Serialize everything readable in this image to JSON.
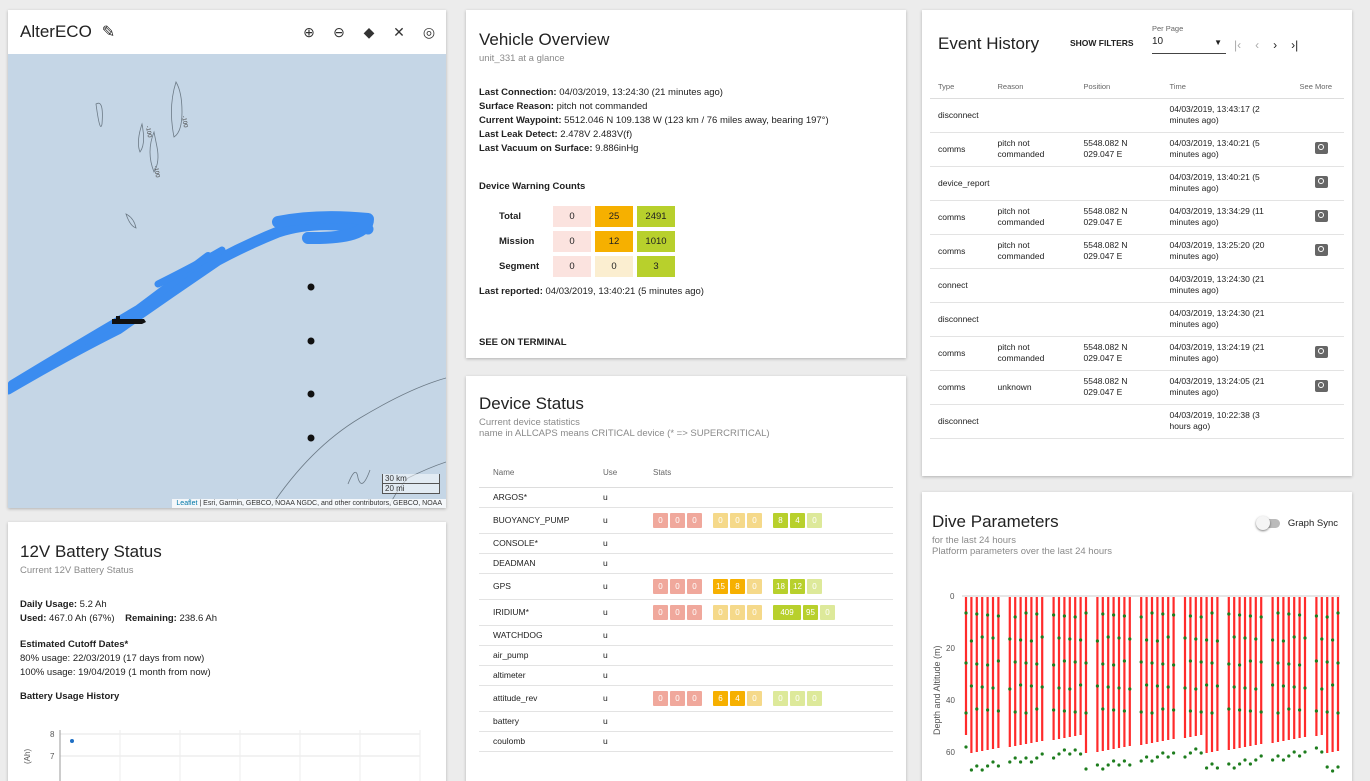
{
  "map": {
    "title": "AlterECO",
    "scale_km": "30 km",
    "scale_mi": "20 mi",
    "attribution_leaflet": "Leaflet",
    "attribution_rest": " | Esri, Garmin, GEBCO, NOAA NGDC, and other contributors, GEBCO, NOAA",
    "contour_labels": [
      "-100",
      "-100",
      "-100"
    ],
    "colors": {
      "water": "#c5d6e6",
      "track": "#3b8cf0",
      "marker": "#111111"
    }
  },
  "battery": {
    "title": "12V Battery Status",
    "subtitle": "Current 12V Battery Status",
    "daily_label": "Daily Usage:",
    "daily_value": " 5.2 Ah",
    "used_label": "Used:",
    "used_value": " 467.0 Ah (67%)",
    "remaining_label": "Remaining:",
    "remaining_value": " 238.6 Ah",
    "cutoff_title": "Estimated Cutoff Dates*",
    "cutoff_80": "80% usage: 22/03/2019 (17 days from now)",
    "cutoff_100": "100% usage: 19/04/2019 (1 month from now)",
    "history_title": "Battery Usage History",
    "chart_ylabel": "(Ah)",
    "chart_ticks": [
      "8",
      "7"
    ]
  },
  "vehicle": {
    "title": "Vehicle Overview",
    "subtitle": "unit_331 at a glance",
    "last_connection_label": "Last Connection:",
    "last_connection_value": " 04/03/2019, 13:24:30 (21 minutes ago)",
    "surface_reason_label": "Surface Reason:",
    "surface_reason_value": " pitch not commanded",
    "waypoint_label": "Current Waypoint:",
    "waypoint_value": " 5512.046 N 109.138 W (123 km / 76 miles away, bearing 197°)",
    "leak_label": "Last Leak Detect:",
    "leak_value": " 2.478V  2.483V(f)",
    "vacuum_label": "Last Vacuum on Surface:",
    "vacuum_value": " 9.886inHg",
    "warnings_title": "Device Warning Counts",
    "warnings": [
      {
        "label": "Total",
        "values": [
          "0",
          "25",
          "2491"
        ]
      },
      {
        "label": "Mission",
        "values": [
          "0",
          "12",
          "1010"
        ]
      },
      {
        "label": "Segment",
        "values": [
          "0",
          "0",
          "3"
        ]
      }
    ],
    "last_reported_label": "Last reported:",
    "last_reported_value": " 04/03/2019, 13:40:21 (5 minutes ago)",
    "see_terminal": "SEE ON TERMINAL"
  },
  "device": {
    "title": "Device Status",
    "subtitle1": "Current device statistics",
    "subtitle2": "name in ALLCAPS means CRITICAL device (* => SUPERCRITICAL)",
    "columns": [
      "Name",
      "Use",
      "Stats"
    ],
    "rows": [
      {
        "name": "ARGOS*",
        "use": "u"
      },
      {
        "name": "BUOYANCY_PUMP",
        "use": "u",
        "stats": [
          [
            "0",
            "0",
            "0"
          ],
          [
            "0",
            "0",
            "0"
          ],
          [
            "8",
            "4",
            "0"
          ]
        ]
      },
      {
        "name": "CONSOLE*",
        "use": "u"
      },
      {
        "name": "DEADMAN",
        "use": "u"
      },
      {
        "name": "GPS",
        "use": "u",
        "stats": [
          [
            "0",
            "0",
            "0"
          ],
          [
            "15",
            "8",
            "0"
          ],
          [
            "18",
            "12",
            "0"
          ]
        ]
      },
      {
        "name": "IRIDIUM*",
        "use": "u",
        "stats": [
          [
            "0",
            "0",
            "0"
          ],
          [
            "0",
            "0",
            "0"
          ],
          [
            "409",
            "95",
            "0"
          ]
        ]
      },
      {
        "name": "WATCHDOG",
        "use": "u"
      },
      {
        "name": "air_pump",
        "use": "u"
      },
      {
        "name": "altimeter",
        "use": "u"
      },
      {
        "name": "attitude_rev",
        "use": "u",
        "stats": [
          [
            "0",
            "0",
            "0"
          ],
          [
            "6",
            "4",
            "0"
          ],
          [
            "0",
            "0",
            "0"
          ]
        ]
      },
      {
        "name": "battery",
        "use": "u"
      },
      {
        "name": "coulomb",
        "use": "u"
      }
    ]
  },
  "events": {
    "title": "Event History",
    "show_filters": "SHOW FILTERS",
    "per_page_label": "Per Page",
    "per_page_value": "10",
    "columns": [
      "Type",
      "Reason",
      "Position",
      "Time",
      "See More"
    ],
    "rows": [
      {
        "type": "disconnect",
        "reason": "",
        "pos1": "",
        "pos2": "",
        "t1": "04/03/2019, 13:43:17 (2",
        "t2": "minutes ago)",
        "more": false
      },
      {
        "type": "comms",
        "reason": "pitch not commanded",
        "pos1": "5548.082 N",
        "pos2": "029.047 E",
        "t1": "04/03/2019, 13:40:21 (5",
        "t2": "minutes ago)",
        "more": true
      },
      {
        "type": "device_report",
        "reason": "",
        "pos1": "",
        "pos2": "",
        "t1": "04/03/2019, 13:40:21 (5",
        "t2": "minutes ago)",
        "more": true
      },
      {
        "type": "comms",
        "reason": "pitch not commanded",
        "pos1": "5548.082 N",
        "pos2": "029.047 E",
        "t1": "04/03/2019, 13:34:29 (11",
        "t2": "minutes ago)",
        "more": true
      },
      {
        "type": "comms",
        "reason": "pitch not commanded",
        "pos1": "5548.082 N",
        "pos2": "029.047 E",
        "t1": "04/03/2019, 13:25:20 (20",
        "t2": "minutes ago)",
        "more": true
      },
      {
        "type": "connect",
        "reason": "",
        "pos1": "",
        "pos2": "",
        "t1": "04/03/2019, 13:24:30 (21",
        "t2": "minutes ago)",
        "more": false
      },
      {
        "type": "disconnect",
        "reason": "",
        "pos1": "",
        "pos2": "",
        "t1": "04/03/2019, 13:24:30 (21",
        "t2": "minutes ago)",
        "more": false
      },
      {
        "type": "comms",
        "reason": "pitch not commanded",
        "pos1": "5548.082 N",
        "pos2": "029.047 E",
        "t1": "04/03/2019, 13:24:19 (21",
        "t2": "minutes ago)",
        "more": true
      },
      {
        "type": "comms",
        "reason": "unknown",
        "pos1": "5548.082 N",
        "pos2": "029.047 E",
        "t1": "04/03/2019, 13:24:05 (21",
        "t2": "minutes ago)",
        "more": true
      },
      {
        "type": "disconnect",
        "reason": "",
        "pos1": "",
        "pos2": "",
        "t1": "04/03/2019, 10:22:38 (3",
        "t2": "hours ago)",
        "more": false
      }
    ]
  },
  "dive": {
    "title": "Dive Parameters",
    "subtitle1": "for the last 24 hours",
    "subtitle2": "Platform parameters over the last 24 hours",
    "graph_sync": "Graph Sync",
    "ylabel": "Depth and Altitude (m)",
    "yticks": [
      "0",
      "20",
      "40",
      "60"
    ],
    "colors": {
      "depth": "#ff2b2b",
      "points": "#1e7d1e"
    }
  },
  "colors": {
    "chip_red": "#f0a89c",
    "chip_red_light": "#fbe3df",
    "chip_orange": "#f6b000",
    "chip_orange_light": "#fbeed0",
    "chip_green": "#b8d02c",
    "chip_green_light": "#dfe9a6"
  }
}
